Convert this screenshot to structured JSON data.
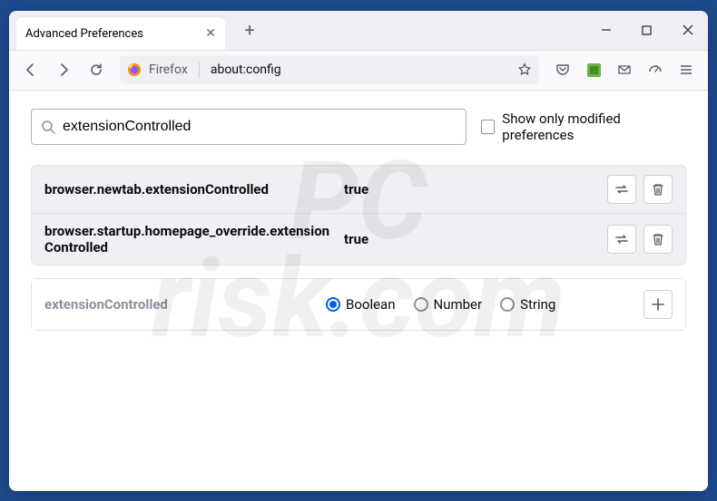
{
  "tab": {
    "title": "Advanced Preferences"
  },
  "url_bar": {
    "label": "Firefox",
    "url": "about:config"
  },
  "search": {
    "value": "extensionControlled",
    "checkbox_label": "Show only modified preferences"
  },
  "prefs": [
    {
      "name": "browser.newtab.extensionControlled",
      "value": "true"
    },
    {
      "name": "browser.startup.homepage_override.extensionControlled",
      "value": "true"
    }
  ],
  "add_row": {
    "name": "extensionControlled",
    "options": {
      "boolean": "Boolean",
      "number": "Number",
      "string": "String"
    }
  }
}
